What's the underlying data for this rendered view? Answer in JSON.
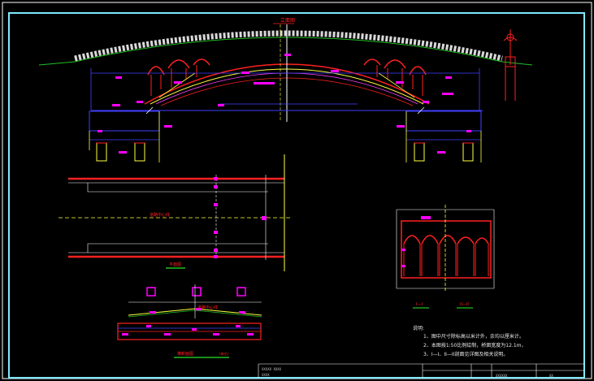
{
  "drawing": {
    "colors": {
      "background": "#000000",
      "frame": "#ffffff",
      "inner_frame": "#7fe8ff",
      "structure": "#ff2020",
      "dimension": "#4040ff",
      "annotation": "#ff00ff",
      "axis": "#ffff40",
      "text": "#e8e8e8",
      "green_mark": "#20c020"
    },
    "labels": {
      "elevation_title": "立面图",
      "plan_title": "平面图",
      "plan_axis": "道路中心线",
      "section_title": "横断面图",
      "section_sub": "(单位)",
      "section_axis": "道路中心线",
      "cut_1": "I—I",
      "cut_2": "II—II"
    },
    "notes": {
      "title": "说明:",
      "items": [
        "1、图中尺寸除标高以米计外，余均以厘米计。",
        "2、本图按1:50比例绘制，桥面宽度为12.1m，",
        "3、I—I、II—II剖面见详图及相关说明。"
      ]
    },
    "title_block": {
      "project": "XXXXX XXXX",
      "drawing_name": "XXXX",
      "sheet": "XXXXXX",
      "number": "XX"
    }
  }
}
